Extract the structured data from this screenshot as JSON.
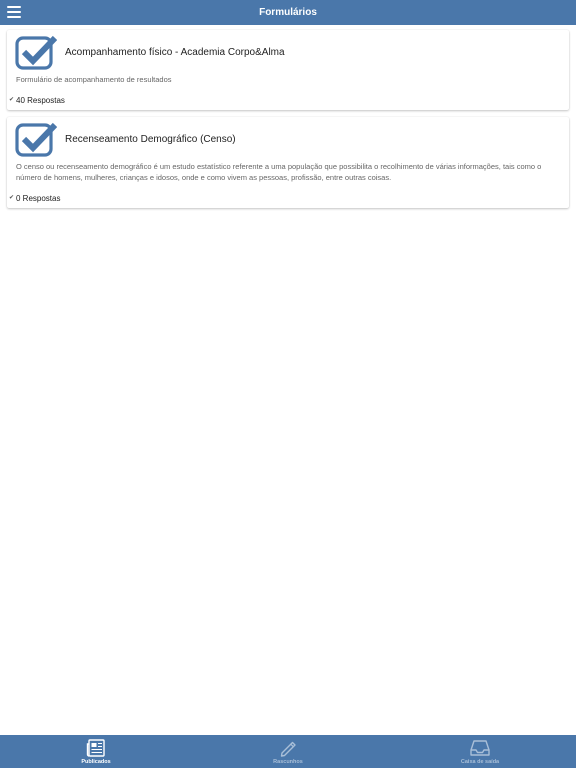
{
  "header": {
    "title": "Formulários"
  },
  "forms": [
    {
      "title": "Acompanhamento físico - Academia Corpo&Alma",
      "description": "Formulário de acompanhamento de resultados",
      "responses": "40 Respostas"
    },
    {
      "title": "Recenseamento Demográfico (Censo)",
      "description": "O censo ou recenseamento demográfico é um estudo estatístico referente a uma população que possibilita o recolhimento de várias informações, tais como o número de homens, mulheres, crianças e idosos, onde e como vivem as pessoas, profissão, entre outras coisas.",
      "responses": "0 Respostas"
    }
  ],
  "tabs": [
    {
      "label": "Publicados",
      "icon": "newspaper-icon",
      "active": true
    },
    {
      "label": "Rascunhos",
      "icon": "pencil-icon",
      "active": false
    },
    {
      "label": "Caixa de saída",
      "icon": "inbox-tray-icon",
      "active": false
    }
  ],
  "colors": {
    "primary": "#4a77aa",
    "tab_active": "#ffffff",
    "tab_inactive": "#a9bfd8"
  }
}
